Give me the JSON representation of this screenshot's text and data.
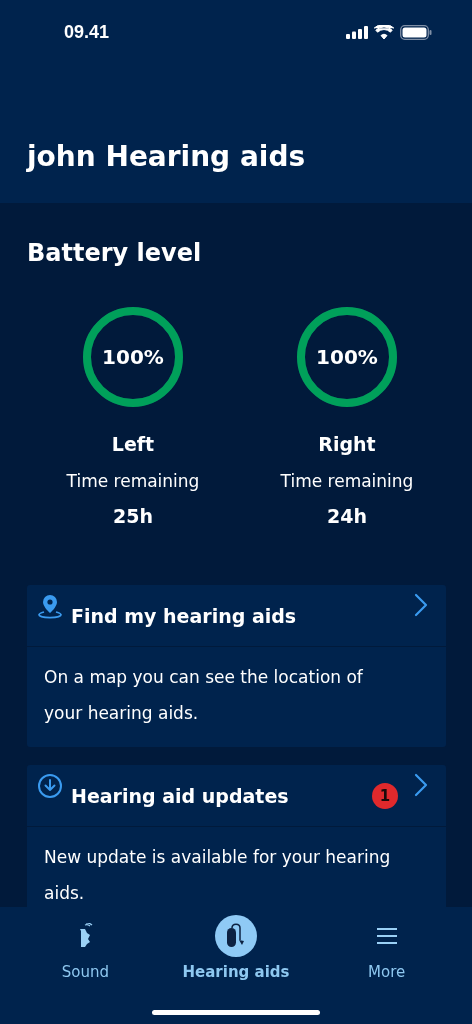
{
  "status_bar": {
    "time": "09.41"
  },
  "header": {
    "title": "john Hearing aids"
  },
  "battery": {
    "title": "Battery level",
    "sides": [
      {
        "label": "Left",
        "percent": "100%",
        "level": 1,
        "caption": "Time remaining",
        "remaining": "25h"
      },
      {
        "label": "Right",
        "percent": "100%",
        "level": 1,
        "caption": "Time remaining",
        "remaining": "24h"
      }
    ]
  },
  "cards": [
    {
      "kind": "location",
      "title": "Find my hearing aids",
      "description": "On a map you can see the location of your hearing aids."
    },
    {
      "kind": "update",
      "title": "Hearing aid updates",
      "badge": "1",
      "description": "New update is available for your hearing aids."
    }
  ],
  "tab_bar": [
    {
      "kind": "sound",
      "label": "Sound",
      "selected": false
    },
    {
      "kind": "hearing-aid",
      "label": "Hearing aids",
      "selected": true
    },
    {
      "kind": "more",
      "label": "More",
      "selected": false
    }
  ]
}
